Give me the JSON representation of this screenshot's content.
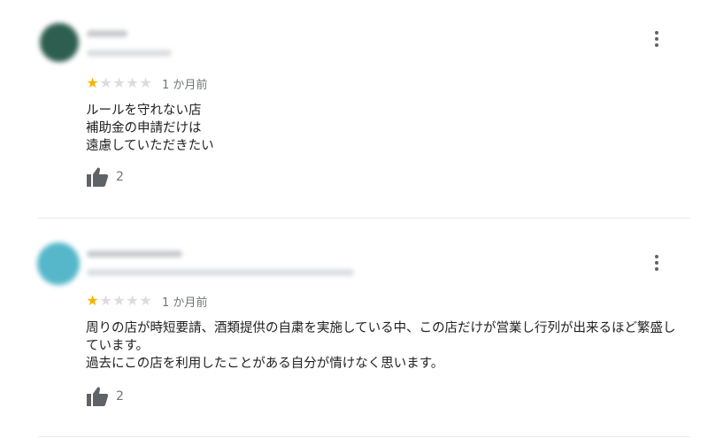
{
  "reviews": [
    {
      "rating_value": 1,
      "rating_max": 5,
      "date": "1 か月前",
      "text_lines": [
        "ルールを守れない店",
        "補助金の申請だけは",
        "遠慮していただきたい"
      ],
      "likes": "2",
      "avatar_color": "#2e5e4f"
    },
    {
      "rating_value": 1,
      "rating_max": 5,
      "date": "1 か月前",
      "text_lines": [
        "周りの店が時短要請、酒類提供の自粛を実施している中、この店だけが営業し行列が出来るほど繁盛し",
        "ています。",
        "過去にこの店を利用したことがある自分が情けなく思います。"
      ],
      "likes": "2",
      "avatar_color": "#55b7c9"
    }
  ],
  "icons": {
    "like": "thumbs-up-icon",
    "menu": "more-vert-icon",
    "star": "star-icon"
  },
  "colors": {
    "star_on": "#f6b300",
    "star_off": "#dadce0"
  }
}
